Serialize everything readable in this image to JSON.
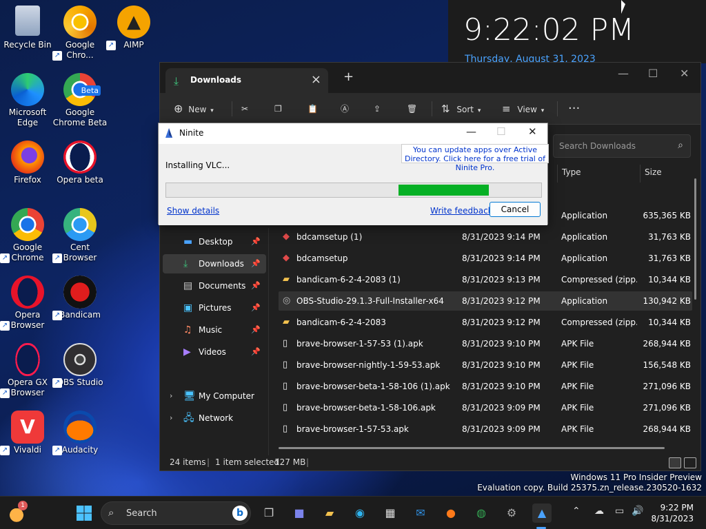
{
  "clock_widget": {
    "time": "9:22:02 PM",
    "date": "Thursday, August 31, 2023"
  },
  "desktop_icons": [
    {
      "label": "Recycle Bin",
      "icon": "recycle-bin-icon"
    },
    {
      "label": "Google Chro...",
      "icon": "chrome-canary-icon"
    },
    {
      "label": "AIMP",
      "icon": "aimp-icon"
    },
    {
      "label": "Microsoft Edge",
      "icon": "edge-icon"
    },
    {
      "label": "Google Chrome Beta",
      "icon": "chrome-beta-icon",
      "badge": "Beta"
    },
    {
      "label": "Firefox",
      "icon": "firefox-icon"
    },
    {
      "label": "Opera beta",
      "icon": "opera-beta-icon"
    },
    {
      "label": "Google Chrome",
      "icon": "chrome-icon"
    },
    {
      "label": "Cent Browser",
      "icon": "cent-browser-icon"
    },
    {
      "label": "Opera Browser",
      "icon": "opera-icon"
    },
    {
      "label": "Bandicam",
      "icon": "bandicam-icon"
    },
    {
      "label": "Opera GX Browser",
      "icon": "opera-gx-icon"
    },
    {
      "label": "OBS Studio",
      "icon": "obs-icon"
    },
    {
      "label": "Vivaldi",
      "icon": "vivaldi-icon"
    },
    {
      "label": "Audacity",
      "icon": "audacity-icon"
    }
  ],
  "explorer": {
    "tab_title": "Downloads",
    "toolbar": {
      "new": "New",
      "sort": "Sort",
      "view": "View"
    },
    "search_placeholder": "Search Downloads",
    "columns": {
      "type": "Type",
      "size": "Size"
    },
    "nav": [
      {
        "label": "Desktop",
        "pinned": true
      },
      {
        "label": "Downloads",
        "pinned": true,
        "selected": true
      },
      {
        "label": "Documents",
        "pinned": true
      },
      {
        "label": "Pictures",
        "pinned": true
      },
      {
        "label": "Music",
        "pinned": true
      },
      {
        "label": "Videos",
        "pinned": true
      },
      {
        "label": "My Computer",
        "expandable": true
      },
      {
        "label": "Network",
        "expandable": true
      }
    ],
    "files": [
      {
        "name": "",
        "date": "",
        "type": "Application",
        "size": "635,365 KB",
        "icon": "app-icon"
      },
      {
        "name": "bdcamsetup (1)",
        "date": "8/31/2023 9:14 PM",
        "type": "Application",
        "size": "31,763 KB",
        "icon": "bandicam-setup-icon"
      },
      {
        "name": "bdcamsetup",
        "date": "8/31/2023 9:14 PM",
        "type": "Application",
        "size": "31,763 KB",
        "icon": "bandicam-setup-icon"
      },
      {
        "name": "bandicam-6-2-4-2083 (1)",
        "date": "8/31/2023 9:13 PM",
        "type": "Compressed (zipp...",
        "size": "10,344 KB",
        "icon": "zip-folder-icon"
      },
      {
        "name": "OBS-Studio-29.1.3-Full-Installer-x64",
        "date": "8/31/2023 9:12 PM",
        "type": "Application",
        "size": "130,942 KB",
        "icon": "obs-icon",
        "selected": true
      },
      {
        "name": "bandicam-6-2-4-2083",
        "date": "8/31/2023 9:12 PM",
        "type": "Compressed (zipp...",
        "size": "10,344 KB",
        "icon": "zip-folder-icon"
      },
      {
        "name": "brave-browser-1-57-53 (1).apk",
        "date": "8/31/2023 9:10 PM",
        "type": "APK File",
        "size": "268,944 KB",
        "icon": "file-icon"
      },
      {
        "name": "brave-browser-nightly-1-59-53.apk",
        "date": "8/31/2023 9:10 PM",
        "type": "APK File",
        "size": "156,548 KB",
        "icon": "file-icon"
      },
      {
        "name": "brave-browser-beta-1-58-106 (1).apk",
        "date": "8/31/2023 9:10 PM",
        "type": "APK File",
        "size": "271,096 KB",
        "icon": "file-icon"
      },
      {
        "name": "brave-browser-beta-1-58-106.apk",
        "date": "8/31/2023 9:09 PM",
        "type": "APK File",
        "size": "271,096 KB",
        "icon": "file-icon"
      },
      {
        "name": "brave-browser-1-57-53.apk",
        "date": "8/31/2023 9:09 PM",
        "type": "APK File",
        "size": "268,944 KB",
        "icon": "file-icon"
      }
    ],
    "status": {
      "items": "24 items",
      "selected": "1 item selected",
      "size": "127 MB"
    }
  },
  "ninite": {
    "title": "Ninite",
    "promo": "You can update apps over Active Directory. Click here for a free trial of Ninite Pro.",
    "status": "Installing VLC...",
    "progress_start": 0.62,
    "progress_end": 0.86,
    "show_details": "Show details",
    "write_feedback": "Write feedback",
    "cancel": "Cancel"
  },
  "watermark": {
    "line1": "Windows 11 Pro Insider Preview",
    "line2": "Evaluation copy. Build 25375.zn_release.230520-1632"
  },
  "taskbar": {
    "search_label": "Search",
    "weather_badge": "1",
    "time": "9:22 PM",
    "date": "8/31/2023"
  }
}
